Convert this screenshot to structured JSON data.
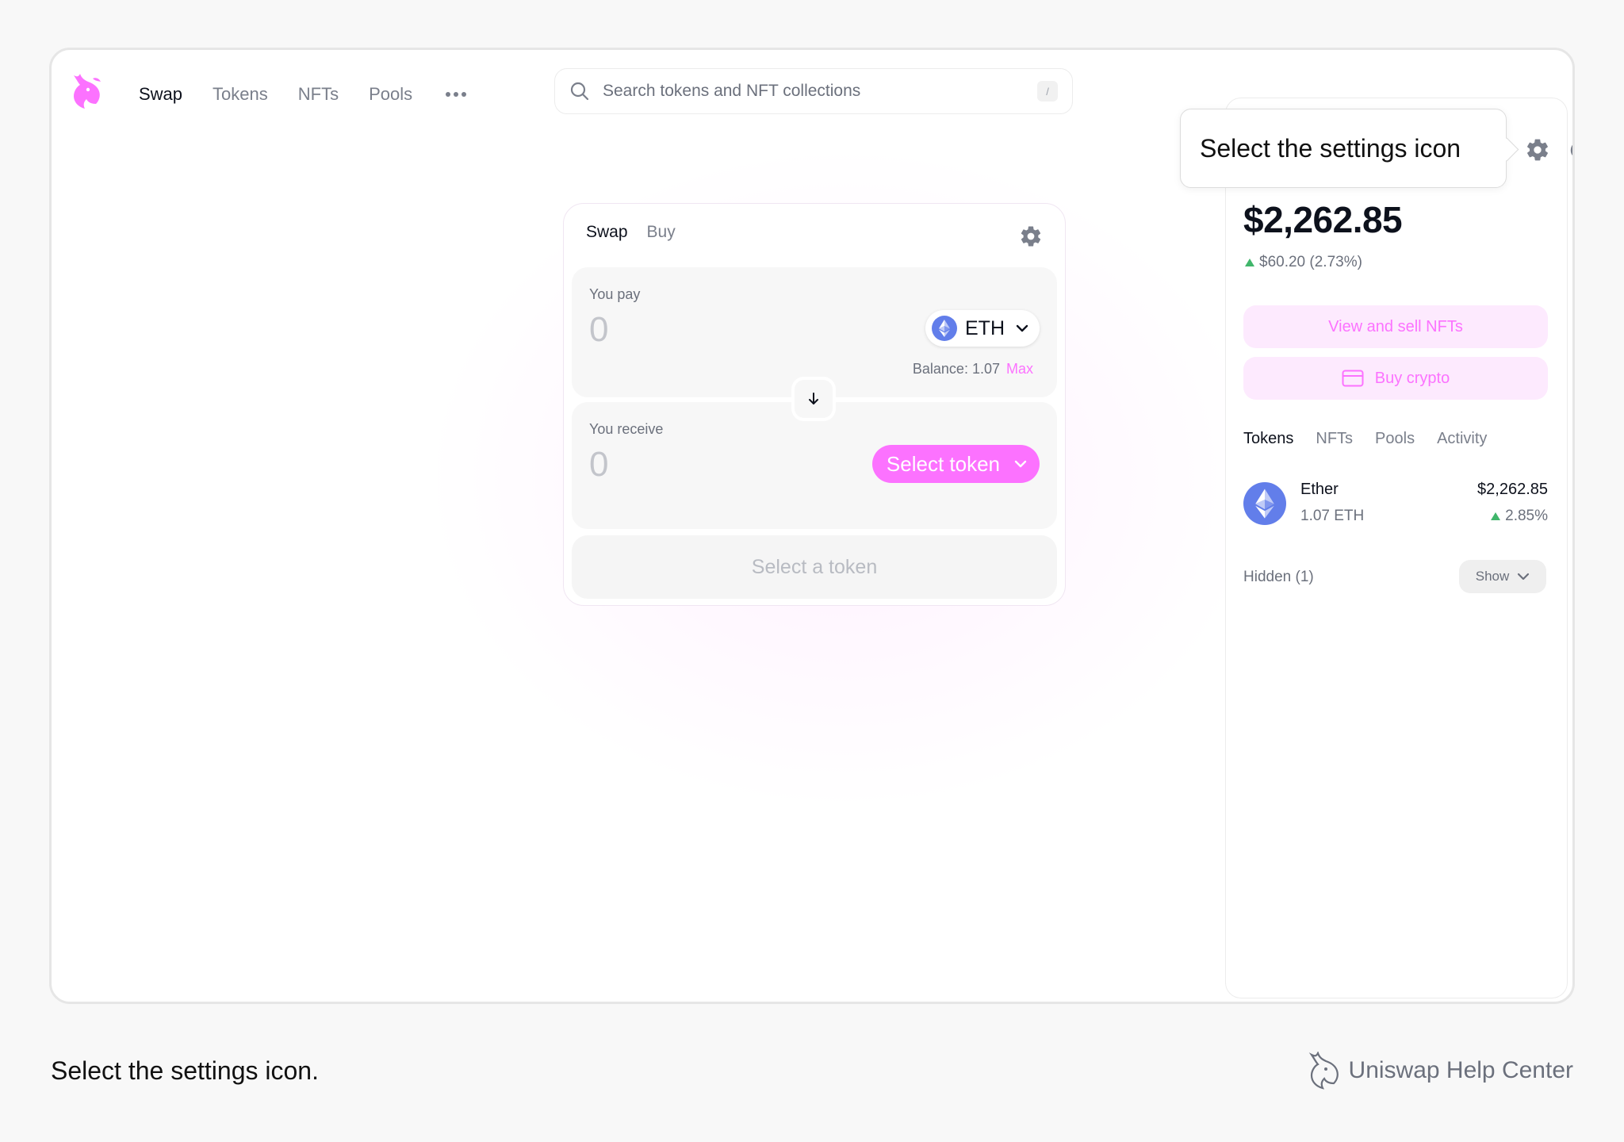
{
  "header": {
    "nav": [
      "Swap",
      "Tokens",
      "NFTs",
      "Pools"
    ],
    "active_nav": "Swap",
    "search_placeholder": "Search tokens and NFT collections",
    "search_shortcut": "/"
  },
  "swap_card": {
    "tabs": [
      "Swap",
      "Buy"
    ],
    "pay_label": "You pay",
    "pay_amount": "0",
    "pay_token": "ETH",
    "balance_label": "Balance: 1.07",
    "max_label": "Max",
    "receive_label": "You receive",
    "receive_amount": "0",
    "select_token_label": "Select token",
    "cta_label": "Select a token"
  },
  "account": {
    "balance": "$2,262.85",
    "delta": "$60.20 (2.73%)",
    "view_nfts_label": "View and sell NFTs",
    "buy_crypto_label": "Buy crypto",
    "tabs": [
      "Tokens",
      "NFTs",
      "Pools",
      "Activity"
    ],
    "tokens": [
      {
        "name": "Ether",
        "amount": "1.07 ETH",
        "value": "$2,262.85",
        "change": "2.85%"
      }
    ],
    "hidden_label": "Hidden (1)",
    "show_label": "Show"
  },
  "callout": {
    "text": "Select the settings icon"
  },
  "footer": {
    "caption": "Select the settings icon.",
    "brand": "Uniswap Help Center"
  },
  "colors": {
    "accent": "#fc72ff",
    "accent_soft": "#fdeafe",
    "positive": "#40b66b",
    "eth": "#627eea"
  },
  "icons": [
    "unicorn-logo-icon",
    "ellipsis-icon",
    "search-icon",
    "gear-icon",
    "power-icon",
    "eth-icon",
    "chevron-down-icon",
    "arrow-down-icon",
    "credit-card-icon",
    "triangle-up-icon"
  ]
}
